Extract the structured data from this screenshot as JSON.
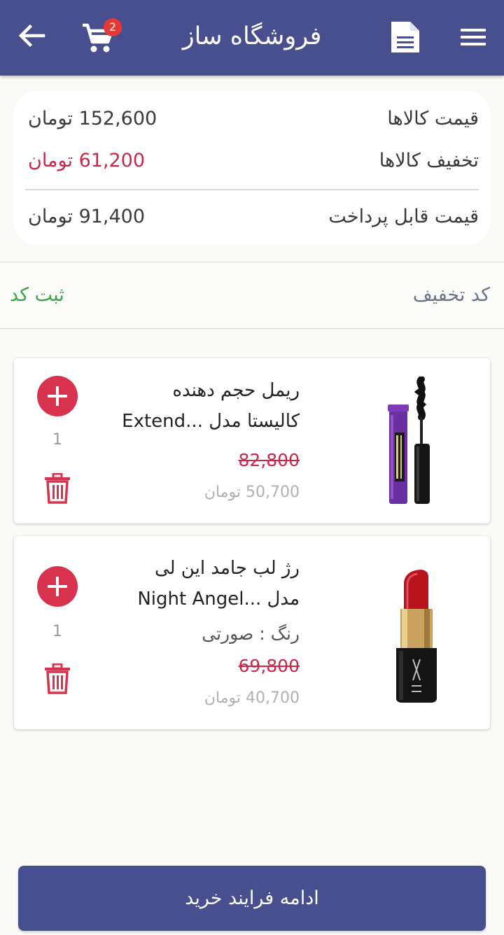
{
  "header": {
    "title": "فروشگاه ساز",
    "cart_count": "2",
    "icons": {
      "menu": "hamburger-menu-icon",
      "document": "document-icon",
      "cart": "shopping-cart-icon",
      "back": "arrow-back-icon"
    }
  },
  "summary": {
    "items_price_label": "قیمت کالاها",
    "items_price_value": "152,600 تومان",
    "discount_label": "تخفیف کالاها",
    "discount_value": "61,200 تومان",
    "payable_label": "قیمت قابل پرداخت",
    "payable_value": "91,400 تومان"
  },
  "coupon": {
    "label": "کد تخفیف",
    "submit": "ثبت کد"
  },
  "products": [
    {
      "name_line1": "ریمل حجم دهنده",
      "name_line2": "کالیستا مدل ...Extend",
      "old_price": "82,800",
      "new_price": "50,700  تومان",
      "quantity": "1",
      "image": "mascara-product-image"
    },
    {
      "name_line1": "رژ لب جامد این لی",
      "name_line2": "مدل ...Night Angel",
      "variant": "رنگ : صورتی",
      "old_price": "69,800",
      "new_price": "40,700  تومان",
      "quantity": "1",
      "image": "lipstick-product-image"
    }
  ],
  "checkout": {
    "label": "ادامه فرایند خرید"
  },
  "colors": {
    "primary": "#474f8f",
    "accent_red": "#d7334f",
    "discount_red": "#c8294a",
    "success_green": "#3fa448"
  }
}
